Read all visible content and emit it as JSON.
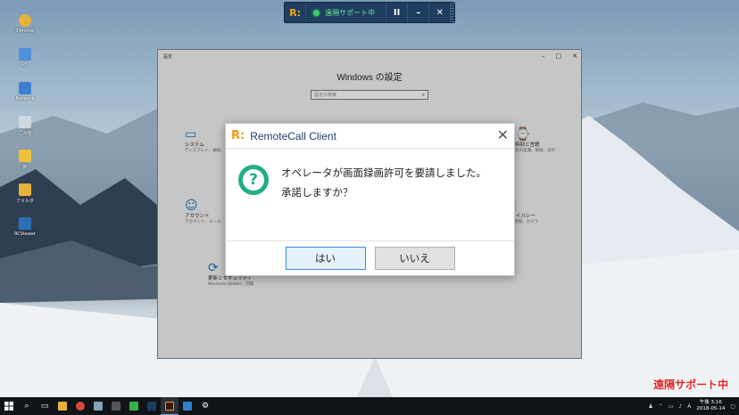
{
  "desktop": {
    "icons": [
      {
        "label": "Chrome",
        "color": "#e8b13a"
      },
      {
        "label": "PC",
        "color": "#4f90d8"
      },
      {
        "label": "Network",
        "color": "#3c7fd0"
      },
      {
        "label": "ごみ箱",
        "color": "#cfd8e0"
      },
      {
        "label": "新",
        "color": "#f0c23a"
      },
      {
        "label": "フォルダ",
        "color": "#e8b13a"
      },
      {
        "label": "RCViewer",
        "color": "#2a6fb6"
      }
    ]
  },
  "toolbar": {
    "logo": "R:",
    "status": "遠隔サポート中",
    "pause": "II",
    "minimize": "–",
    "close": "✕"
  },
  "settings": {
    "window_title": "設定",
    "heading": "Windows の設定",
    "search_placeholder": "設定の検索",
    "items": [
      {
        "name": "システム",
        "desc": "ディスプレイ、通知、電源"
      },
      {
        "name": "時刻と言語",
        "desc": "音声認識、地域、日付"
      },
      {
        "name": "アカウント",
        "desc": "アカウント、メール、同期、職場"
      },
      {
        "name": "プライバシー",
        "desc": "位置情報、カメラ"
      },
      {
        "name": "更新とセキュリティ",
        "desc": "Windows Update、回復"
      }
    ]
  },
  "dialog": {
    "logo": "R:",
    "title": "RemoteCall Client",
    "message_line1": "オペレータが画面録画許可を要請しました。",
    "message_line2": "承諾しますか？",
    "yes_label": "はい",
    "no_label": "いいえ"
  },
  "watermark": "遠隔サポート中",
  "taskbar": {
    "clock_time": "午後 3:16",
    "clock_date": "2018-05-14",
    "ime": "A",
    "apps": [
      {
        "name": "file-explorer",
        "color": "#e8b13a"
      },
      {
        "name": "chrome",
        "color": "#d9483b"
      },
      {
        "name": "app3",
        "color": "#8aa0b5"
      },
      {
        "name": "calculator",
        "color": "#555555"
      },
      {
        "name": "line",
        "color": "#33b34a"
      },
      {
        "name": "photoshop",
        "color": "#1b3c63"
      },
      {
        "name": "illustrator",
        "color": "#3a1a05"
      },
      {
        "name": "app8",
        "color": "#2f7fd2"
      },
      {
        "name": "settings",
        "color": "#cccccc"
      }
    ]
  }
}
